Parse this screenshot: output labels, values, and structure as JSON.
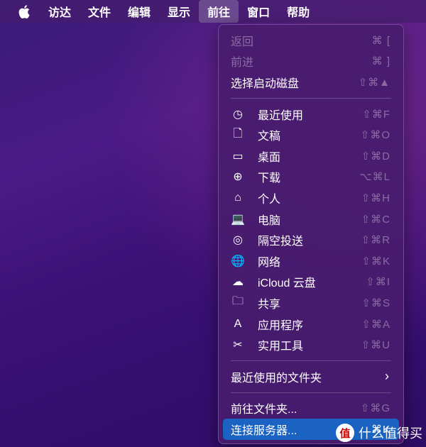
{
  "menubar": {
    "apple": "",
    "items": [
      "访达",
      "文件",
      "编辑",
      "显示",
      "前往",
      "窗口",
      "帮助"
    ],
    "active": "前往"
  },
  "menu": {
    "top": [
      {
        "label": "返回",
        "shortcut": "⌘ [",
        "disabled": true
      },
      {
        "label": "前进",
        "shortcut": "⌘ ]",
        "disabled": true
      },
      {
        "label": "选择启动磁盘",
        "shortcut": "⇧⌘▲",
        "disabled": false
      }
    ],
    "places": [
      {
        "icon": "clock-icon",
        "glyph": "◷",
        "label": "最近使用",
        "shortcut": "⇧⌘F"
      },
      {
        "icon": "document-icon",
        "glyph": "🗋",
        "label": "文稿",
        "shortcut": "⇧⌘O"
      },
      {
        "icon": "desktop-icon",
        "glyph": "▭",
        "label": "桌面",
        "shortcut": "⇧⌘D"
      },
      {
        "icon": "download-icon",
        "glyph": "⊕",
        "label": "下载",
        "shortcut": "⌥⌘L"
      },
      {
        "icon": "home-icon",
        "glyph": "⌂",
        "label": "个人",
        "shortcut": "⇧⌘H"
      },
      {
        "icon": "computer-icon",
        "glyph": "💻",
        "label": "电脑",
        "shortcut": "⇧⌘C"
      },
      {
        "icon": "airdrop-icon",
        "glyph": "◎",
        "label": "隔空投送",
        "shortcut": "⇧⌘R"
      },
      {
        "icon": "network-icon",
        "glyph": "🌐",
        "label": "网络",
        "shortcut": "⇧⌘K"
      },
      {
        "icon": "icloud-icon",
        "glyph": "☁",
        "label": "iCloud 云盘",
        "shortcut": "⇧⌘I"
      },
      {
        "icon": "shared-folder-icon",
        "glyph": "🗀",
        "label": "共享",
        "shortcut": "⇧⌘S"
      },
      {
        "icon": "applications-icon",
        "glyph": "A",
        "label": "应用程序",
        "shortcut": "⇧⌘A"
      },
      {
        "icon": "utilities-icon",
        "glyph": "✂",
        "label": "实用工具",
        "shortcut": "⇧⌘U"
      }
    ],
    "recent_folders": "最近使用的文件夹",
    "goto_folder": {
      "label": "前往文件夹...",
      "shortcut": "⇧⌘G"
    },
    "connect_server": {
      "label": "连接服务器...",
      "shortcut": "⌘K"
    }
  },
  "watermark": {
    "badge": "值",
    "text": "什么值得买"
  }
}
